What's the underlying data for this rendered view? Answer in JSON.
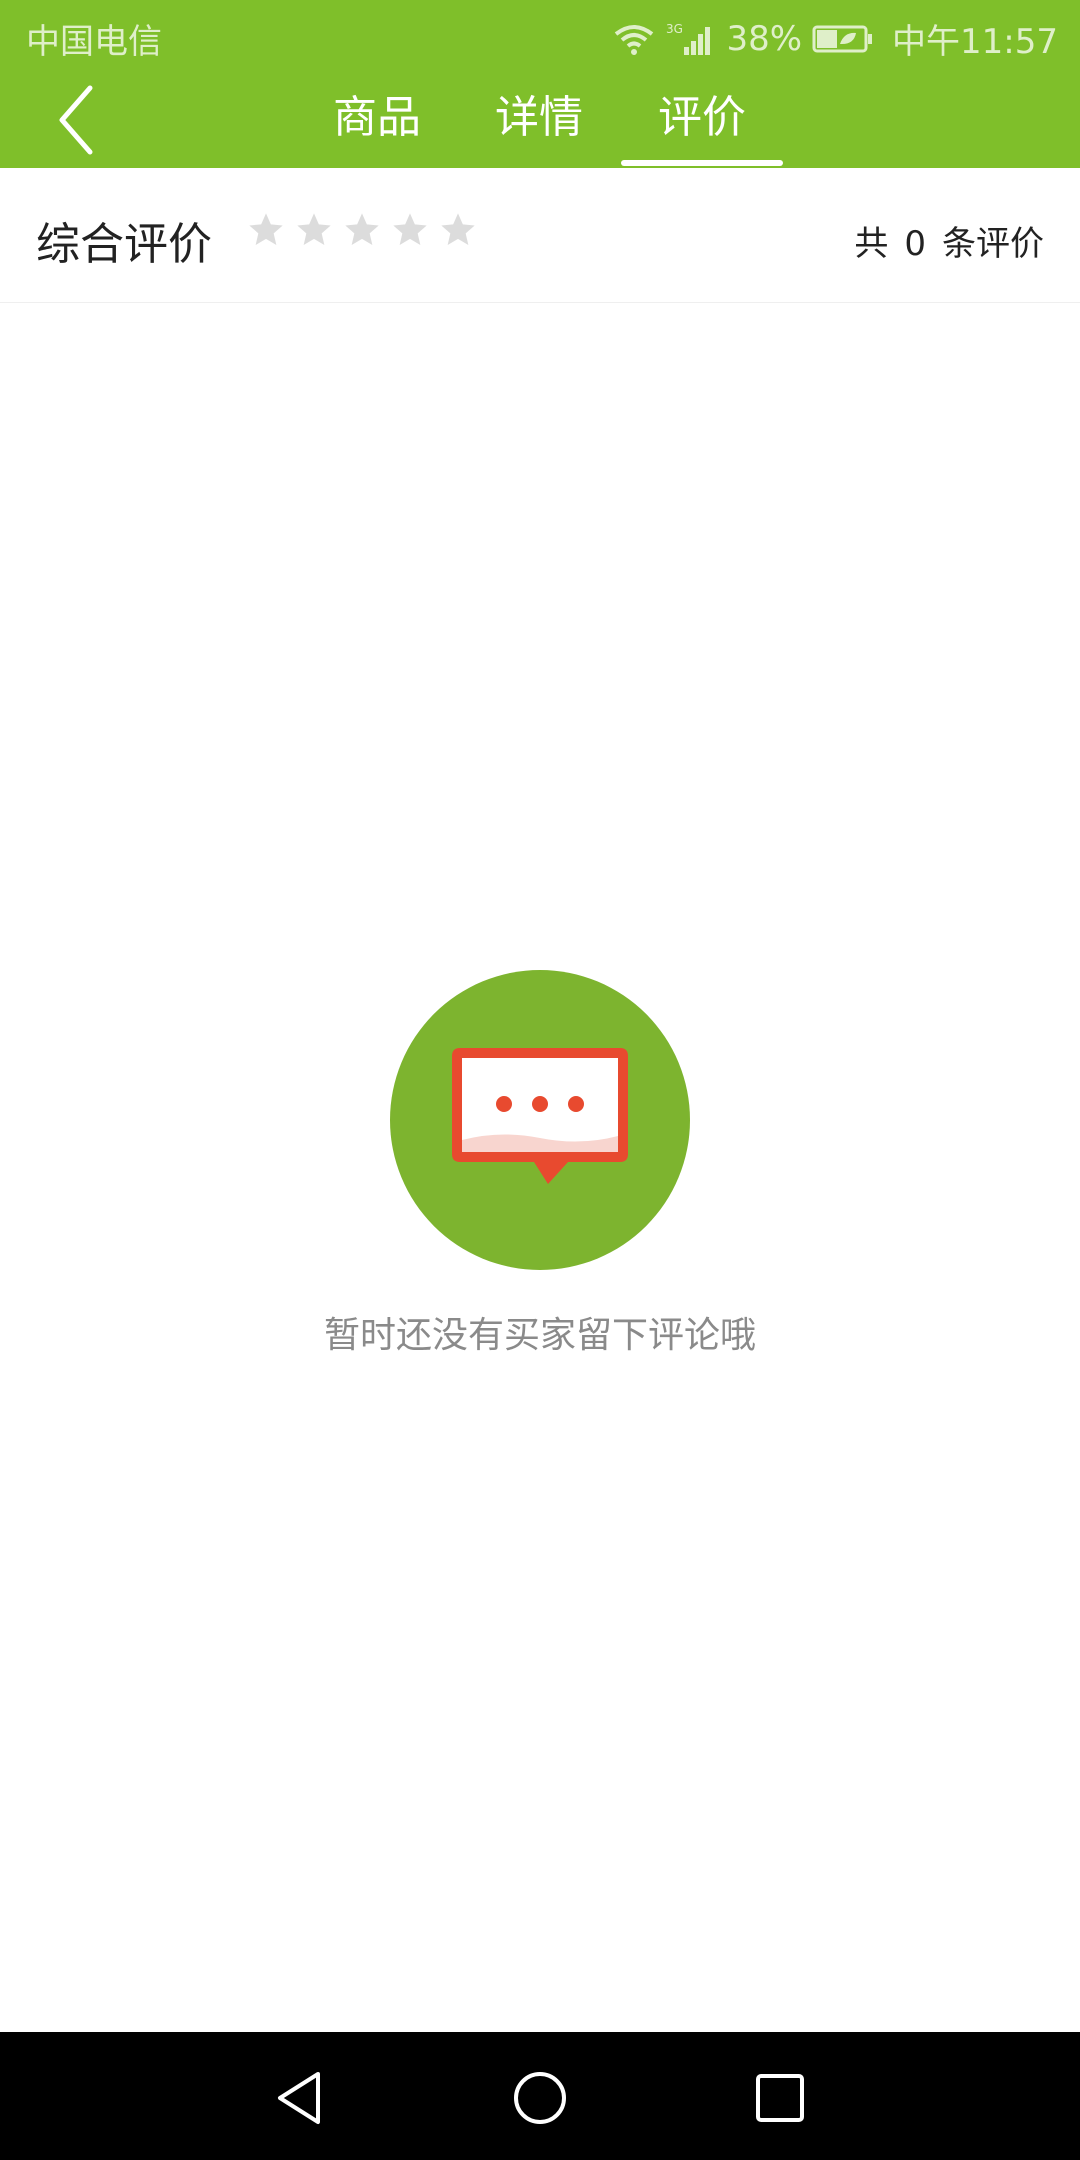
{
  "status_bar": {
    "carrier": "中国电信",
    "network": "3G",
    "battery": "38%",
    "time": "中午11:57"
  },
  "nav": {
    "tabs": [
      {
        "label": "商品",
        "active": false
      },
      {
        "label": "详情",
        "active": false
      },
      {
        "label": "评价",
        "active": true
      }
    ]
  },
  "rating": {
    "title": "综合评价",
    "stars_filled": 0,
    "stars_total": 5,
    "count_prefix": "共",
    "count": "0",
    "count_suffix": "条评价"
  },
  "empty_state": {
    "message": "暂时还没有买家留下评论哦",
    "icon": "chat-bubble-icon"
  },
  "colors": {
    "primary": "#7fbf2a",
    "icon_circle": "#7db42f",
    "bubble_red": "#e84a2f",
    "star_gray": "#dcdcdc"
  }
}
